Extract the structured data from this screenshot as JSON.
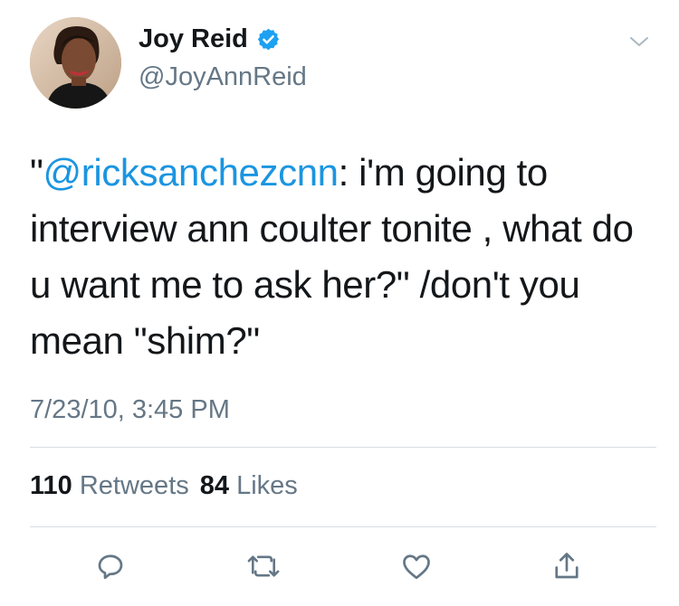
{
  "author": {
    "name": "Joy Reid",
    "handle": "@JoyAnnReid",
    "verified": true
  },
  "tweet": {
    "open_quote": "\"",
    "mention": "@ricksanchezcnn",
    "text_after_mention": ": i'm going to interview ann coulter tonite , what do u want me to ask her?\" /don't you mean \"shim?\"",
    "timestamp": "7/23/10, 3:45 PM"
  },
  "stats": {
    "retweets_count": "110",
    "retweets_label": "Retweets",
    "likes_count": "84",
    "likes_label": "Likes"
  },
  "actions": [
    "reply-icon",
    "retweet-icon",
    "like-icon",
    "share-icon"
  ],
  "colors": {
    "text": "#14171a",
    "secondary": "#657786",
    "link": "#1b95e0",
    "verified": "#1da1f2",
    "divider": "#d8dde1"
  }
}
